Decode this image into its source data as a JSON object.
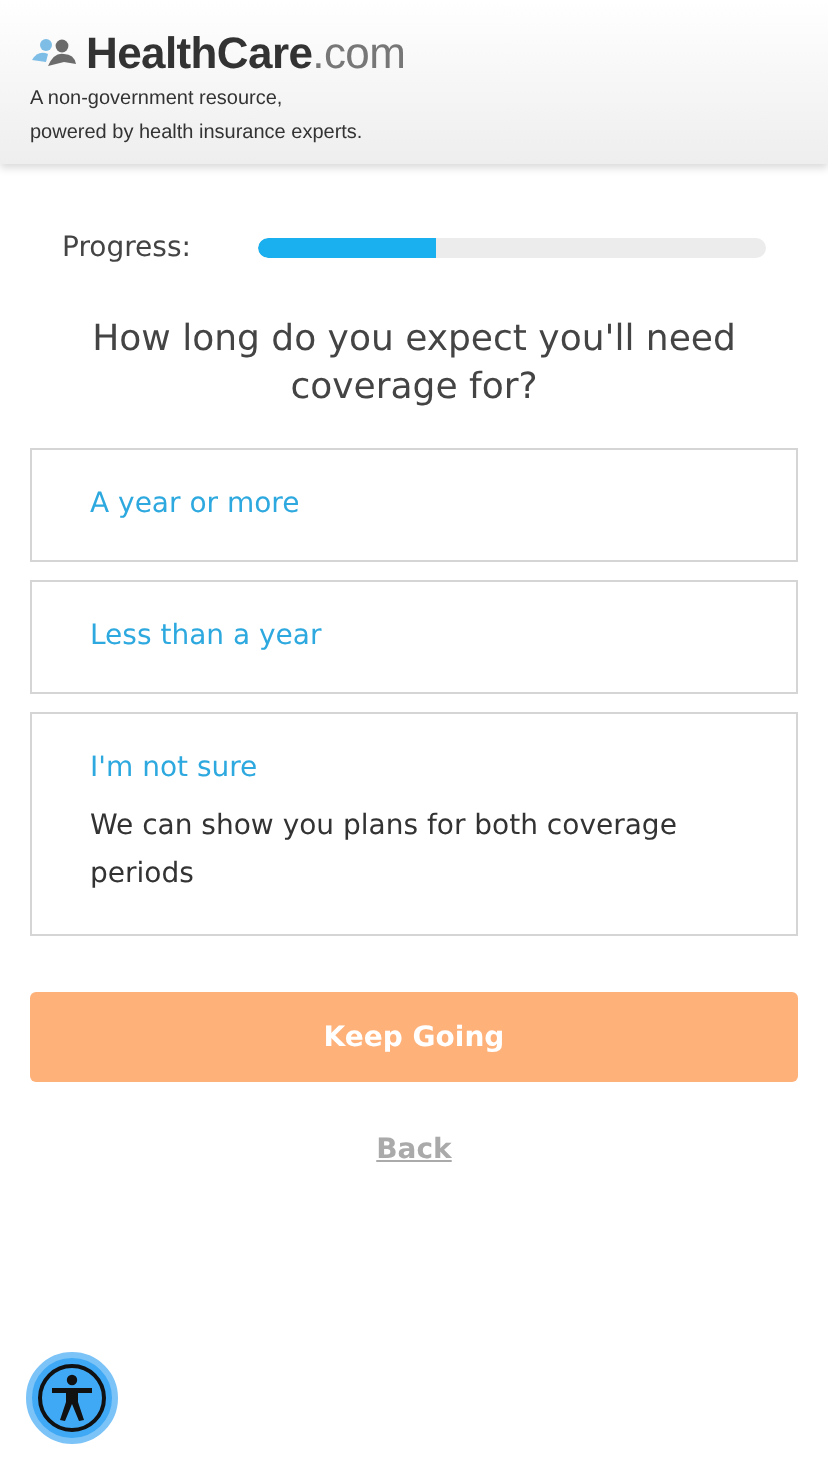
{
  "header": {
    "logo": {
      "name": "HealthCare",
      "suffix": ".com"
    },
    "tagline_lines": [
      "A non-government resource,",
      "powered by health insurance experts."
    ]
  },
  "progress": {
    "label": "Progress:",
    "level": 0.35
  },
  "question": "How long do you expect you'll need coverage for?",
  "options": [
    {
      "label": "A year or more",
      "selected": false
    },
    {
      "label": "Less than a year",
      "selected": false
    },
    {
      "label": "I'm not sure",
      "description": "We can show you plans for both coverage periods",
      "selected": false
    }
  ],
  "primary_button": {
    "label": "Keep Going",
    "disabled": true
  },
  "back_link": "Back"
}
